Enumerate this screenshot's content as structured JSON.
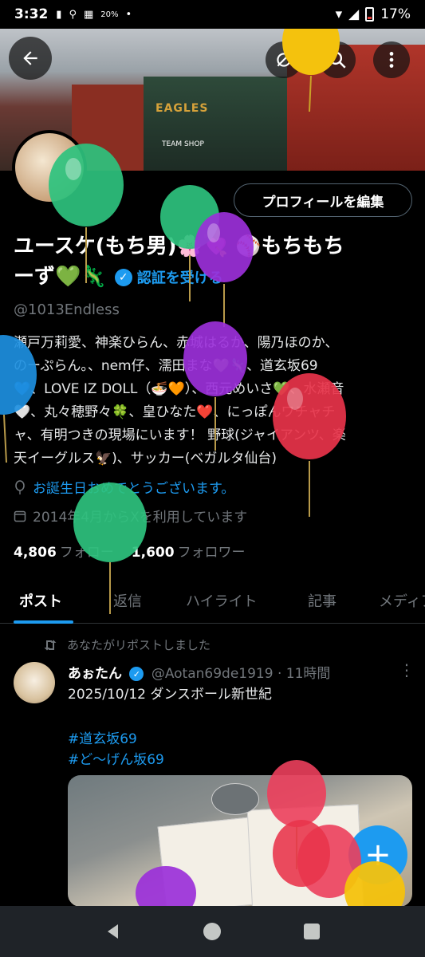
{
  "status_bar": {
    "time": "3:32",
    "data_speed": "20%",
    "battery": "17%"
  },
  "profile": {
    "edit_button": "プロフィールを編集",
    "name_line1": "ユースケ(もち男)🌸💘 ⚾もちもち",
    "name_line2": "ーず💚🦎",
    "verify_link": "認証を受ける",
    "handle": "@1013Endless",
    "bio_lines": [
      "瀬戸万莉愛、神楽ひらん、赤城はるか、陽乃ほのか、",
      "のーぷらん。、nem仔、濡田まな💚🦎、道玄坂69",
      "💙、LOVE IZ DOLL（🍜🧡）、西元めいさ💚、水瀬音",
      "🤍、丸々穂野々🍀、皇ひなた❤️、にっぽんワチャチ",
      "ャ、有明つきの現場にいます！ 野球(ジャイアンツ、楽",
      "天イーグルス🦅)、サッカー(ベガルタ仙台)"
    ],
    "birthday": "お誕生日おめでとうございます。",
    "joined": "2014年4月からXを利用しています",
    "following_count": "4,806",
    "following_label": "フォロー",
    "followers_count": "1,600",
    "followers_label": "フォロワー"
  },
  "banner": {
    "sign": "EAGLES",
    "sign2": "TEAM SHOP"
  },
  "tabs": [
    {
      "label": "ポスト"
    },
    {
      "label": "返信"
    },
    {
      "label": "ハイライト"
    },
    {
      "label": "記事"
    },
    {
      "label": "メディア"
    }
  ],
  "post": {
    "repost_label": "あなたがリポストしました",
    "author_name": "あぉたん",
    "author_handle": "@Aotan69de1919",
    "time": "11時間",
    "separator": "·",
    "text": "2025/10/12 ダンスボール新世紀",
    "hashtags": [
      "#道玄坂69",
      "#ど〜げん坂69"
    ]
  },
  "icons": {
    "back": "arrow-left-icon",
    "no_notify": "bell-off-icon",
    "search": "search-icon",
    "more": "more-vertical-icon",
    "compose": "plus-icon"
  }
}
